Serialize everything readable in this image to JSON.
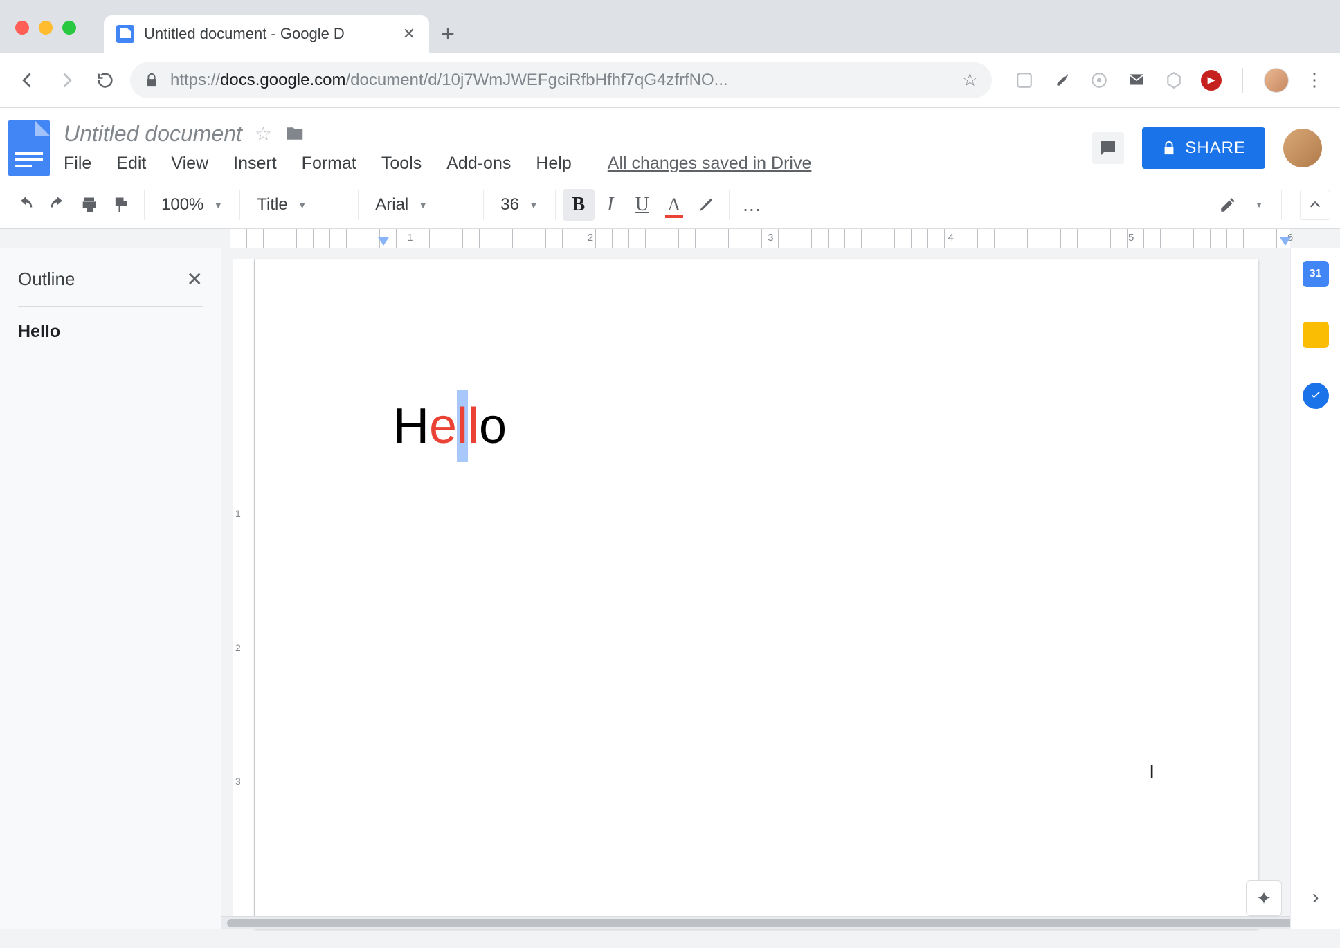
{
  "browser": {
    "tab_title": "Untitled document - Google D",
    "url_host": "https://",
    "url_domain": "docs.google.com",
    "url_path": "/document/d/10j7WmJWEFgciRfbHfhf7qG4zfrfNO..."
  },
  "header": {
    "doc_title": "Untitled document",
    "menus": [
      "File",
      "Edit",
      "View",
      "Insert",
      "Format",
      "Tools",
      "Add-ons",
      "Help"
    ],
    "save_status": "All changes saved in Drive",
    "share_label": "SHARE"
  },
  "toolbar": {
    "zoom": "100%",
    "style": "Title",
    "font": "Arial",
    "font_size": "36",
    "bold": "B",
    "italic": "I",
    "underline": "U",
    "text_color": "A",
    "more": "…"
  },
  "ruler": {
    "numbers": [
      "1",
      "2",
      "3",
      "4",
      "5",
      "6"
    ]
  },
  "outline": {
    "title": "Outline",
    "items": [
      "Hello"
    ]
  },
  "document": {
    "word_parts": {
      "p1": "H",
      "p2": "e",
      "p3": "l",
      "p4": "l",
      "p5": "o"
    }
  },
  "side": {
    "calendar_day": "31"
  },
  "vruler": {
    "numbers": [
      "1",
      "2",
      "3"
    ]
  }
}
